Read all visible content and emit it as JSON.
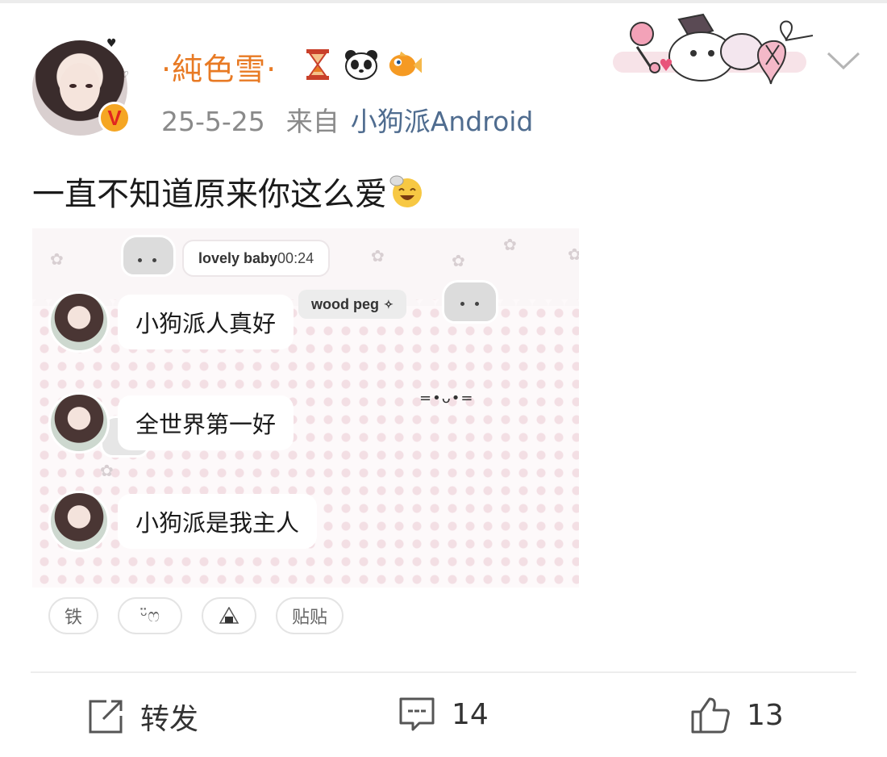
{
  "post": {
    "author": {
      "name": "·純色雪·",
      "badge_icons": [
        "hourglass-icon",
        "panda-icon",
        "fish-icon"
      ],
      "verified_badge": "V"
    },
    "date": "25-5-25",
    "source_prefix": "来自",
    "source": "小狗派Android",
    "text": "一直不知道原来你这么爱"
  },
  "image": {
    "top_bubble": "lovely baby",
    "top_time": "00:24",
    "second_bubble": "wood peg",
    "kaomoji": "=•ᴗ•=",
    "messages": [
      {
        "text": "小狗派人真好"
      },
      {
        "text": "全世界第一好"
      },
      {
        "text": "小狗派是我主人"
      }
    ]
  },
  "tags": [
    "铁",
    "ᵕ̈ෆ",
    "",
    "贴贴"
  ],
  "actions": {
    "repost_label": "转发",
    "comment_count": "14",
    "like_count": "13"
  },
  "colors": {
    "name": "#e87a24",
    "source_link": "#4f6c8f",
    "meta": "#8a8a8a"
  }
}
